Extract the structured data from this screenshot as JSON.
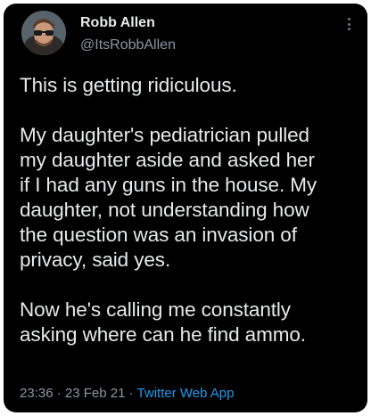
{
  "tweet": {
    "author_name": "Robb Allen",
    "author_handle": "@ItsRobbAllen",
    "paragraphs": [
      "This is getting ridiculous.",
      "My daughter's pediatrician pulled\nmy daughter aside and asked her\nif I had any guns in the house. My\ndaughter, not understanding how\nthe question was an invasion of\nprivacy, said yes.",
      "Now he's calling me constantly\nasking where can he find ammo."
    ],
    "time": "23:36",
    "separator": "·",
    "date": "23 Feb 21",
    "source_app": "Twitter Web App"
  },
  "icons": {
    "more": "more-options-icon"
  },
  "colors": {
    "background": "#000000",
    "text": "#e7e9ea",
    "muted": "#8b98a5",
    "link": "#1d9bf0"
  }
}
